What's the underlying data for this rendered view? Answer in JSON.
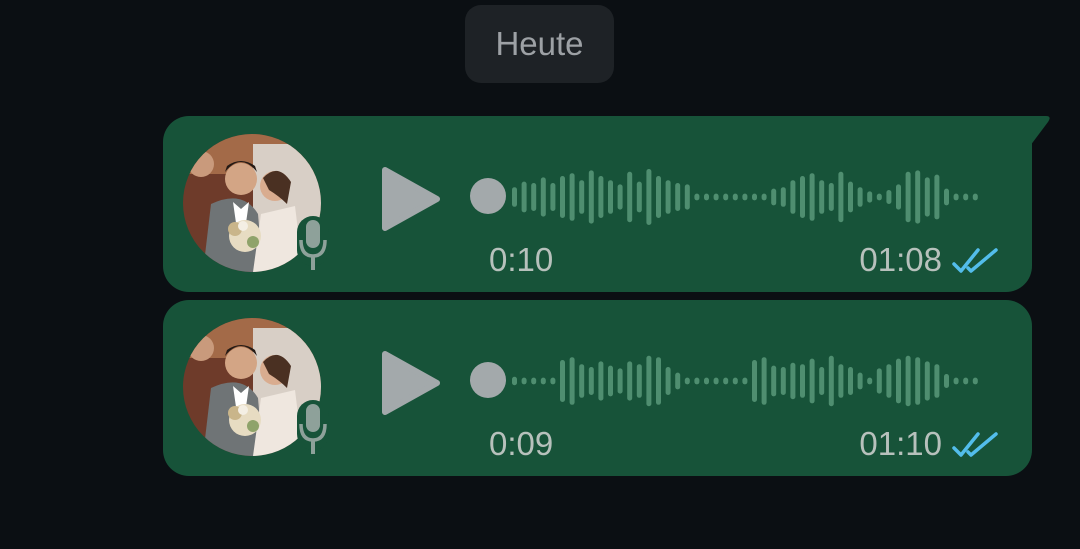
{
  "date_separator": "Heute",
  "messages": [
    {
      "type": "voice",
      "elapsed": "0:10",
      "sent_time": "01:08",
      "status": "read",
      "waveform": [
        0.35,
        0.55,
        0.5,
        0.7,
        0.5,
        0.75,
        0.85,
        0.6,
        0.95,
        0.75,
        0.6,
        0.45,
        0.9,
        0.55,
        1.0,
        0.75,
        0.6,
        0.5,
        0.45,
        0.12,
        0.12,
        0.12,
        0.12,
        0.12,
        0.12,
        0.12,
        0.12,
        0.3,
        0.35,
        0.6,
        0.75,
        0.85,
        0.6,
        0.5,
        0.9,
        0.55,
        0.35,
        0.2,
        0.12,
        0.25,
        0.45,
        0.9,
        0.95,
        0.7,
        0.8,
        0.3,
        0.12,
        0.12,
        0.12
      ]
    },
    {
      "type": "voice",
      "elapsed": "0:09",
      "sent_time": "01:10",
      "status": "read",
      "waveform": [
        0.15,
        0.12,
        0.12,
        0.12,
        0.12,
        0.75,
        0.85,
        0.6,
        0.5,
        0.7,
        0.55,
        0.45,
        0.7,
        0.6,
        0.9,
        0.85,
        0.5,
        0.3,
        0.12,
        0.12,
        0.12,
        0.12,
        0.12,
        0.12,
        0.12,
        0.75,
        0.85,
        0.55,
        0.5,
        0.65,
        0.6,
        0.8,
        0.5,
        0.9,
        0.6,
        0.5,
        0.3,
        0.12,
        0.45,
        0.6,
        0.8,
        0.9,
        0.85,
        0.7,
        0.6,
        0.25,
        0.12,
        0.12,
        0.12
      ]
    }
  ],
  "colors": {
    "background": "#0b0f13",
    "bubble": "#175339",
    "waveform": "#4f8e70",
    "read_ticks": "#53bdeb",
    "play": "#a3a9ab"
  }
}
